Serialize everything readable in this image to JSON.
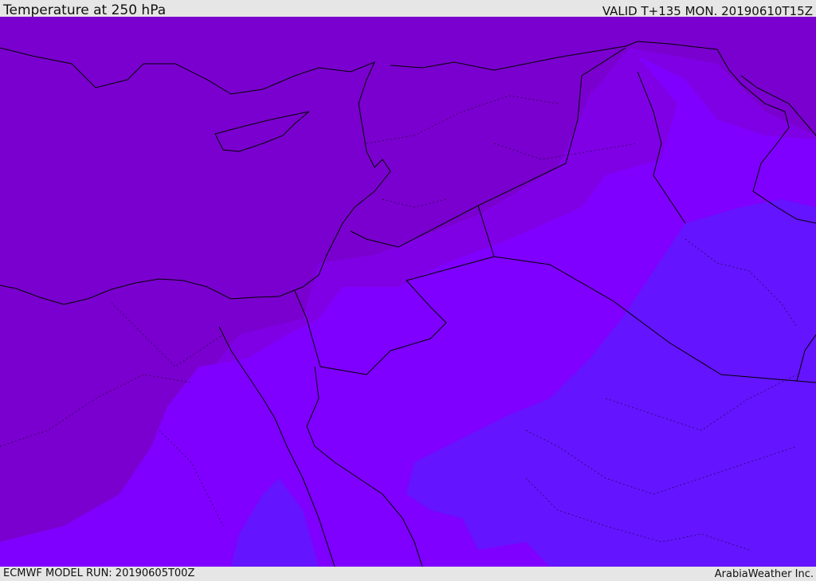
{
  "header": {
    "title": "Temperature at 250 hPa",
    "valid_time": "VALID T+135 MON. 20190610T15Z"
  },
  "footer": {
    "model_run": "ECMWF MODEL RUN: 20190605T00Z",
    "credit": "ArabiaWeather Inc."
  },
  "colors": {
    "band_warmest": "#7a00cf",
    "band_warm": "#8000e6",
    "band_mid": "#7f00ff",
    "band_cool": "#6414ff",
    "borders": "#000000",
    "frame": "#e6e6e6"
  }
}
